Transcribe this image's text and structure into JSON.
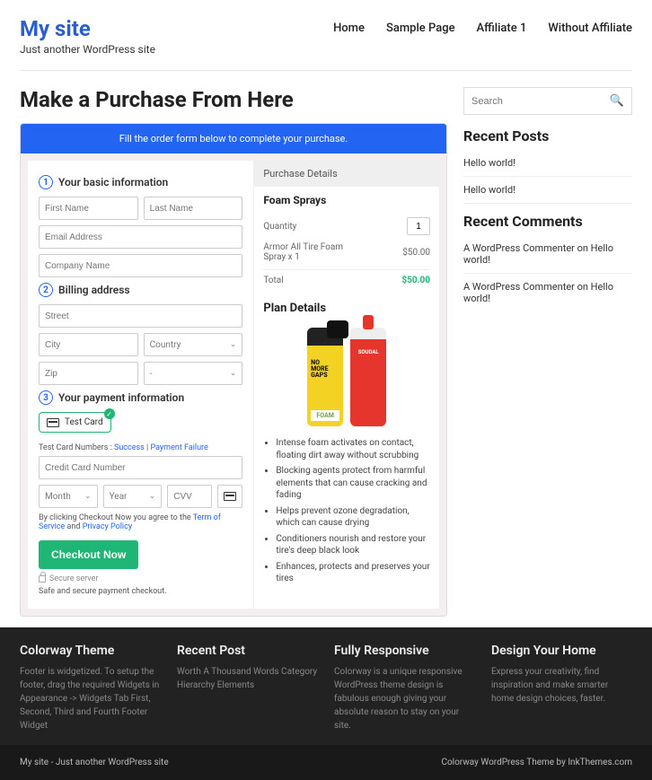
{
  "brand": {
    "title": "My site",
    "tagline": "Just another WordPress site"
  },
  "nav": {
    "home": "Home",
    "sample": "Sample Page",
    "affiliate": "Affiliate 1",
    "without": "Without Affiliate"
  },
  "page": {
    "title": "Make a Purchase From Here"
  },
  "checkout": {
    "banner": "Fill the order form below to complete your purchase.",
    "step1": {
      "num": "1",
      "title": "Your basic information",
      "first": "First Name",
      "last": "Last Name",
      "email": "Email Address",
      "company": "Company Name"
    },
    "step2": {
      "num": "2",
      "title": "Billing address",
      "street": "Street",
      "city": "City",
      "country": "Country",
      "zip": "Zip",
      "state": "-"
    },
    "step3": {
      "num": "3",
      "title": "Your payment information",
      "testcard": "Test Card",
      "note_pre": "Test Card Numbers : ",
      "note_success": "Success",
      "note_sep": " | ",
      "note_fail": "Payment Failure",
      "cc": "Credit Card Number",
      "month": "Month",
      "year": "Year",
      "cvv": "CVV",
      "terms_pre": "By clicking Checkout Now you agree to the ",
      "terms_tos": "Term of Service",
      "terms_and": " and ",
      "terms_pp": "Privacy Policy",
      "button": "Checkout Now",
      "secure": "Secure server",
      "safe": "Safe and secure payment checkout."
    }
  },
  "purchase": {
    "header": "Purchase Details",
    "product": "Foam Sprays",
    "qty_label": "Quantity",
    "qty_value": "1",
    "line_item": "Armor All Tire Foam Spray x 1",
    "line_price": "$50.00",
    "total_label": "Total",
    "total_value": "$50.00"
  },
  "plan": {
    "header": "Plan Details",
    "can1a": "NO",
    "can1b": "MORE",
    "can1c": "GAPS",
    "can1d": "FOAM",
    "can2": "SOUDAL",
    "bullets": [
      "Intense foam activates on contact, floating dirt away without scrubbing",
      "Blocking agents protect from harmful elements that can cause cracking and fading",
      "Helps prevent ozone degradation, which can cause drying",
      "Conditioners nourish and restore your tire's deep black look",
      "Enhances, protects and preserves your tires"
    ]
  },
  "sidebar": {
    "search": "Search",
    "recent_posts": {
      "title": "Recent Posts",
      "items": [
        "Hello world!",
        "Hello world!"
      ]
    },
    "recent_comments": {
      "title": "Recent Comments",
      "items": [
        "A WordPress Commenter on Hello world!",
        "A WordPress Commenter on Hello world!"
      ]
    }
  },
  "footer": {
    "cols": [
      {
        "title": "Colorway Theme",
        "body": "Footer is widgetized. To setup the footer, drag the required Widgets in Appearance -> Widgets Tab First, Second, Third and Fourth Footer Widget"
      },
      {
        "title": "Recent Post",
        "body": "Worth A Thousand Words Category Hierarchy Elements"
      },
      {
        "title": "Fully Responsive",
        "body": "Colorway is a unique responsive WordPress theme design is fabulous enough giving your absolute reason to stay on your site."
      },
      {
        "title": "Design Your Home",
        "body": "Express your creativity, find inspiration and make smarter home design choices, faster."
      }
    ],
    "bar_left": "My site - Just another WordPress site",
    "bar_right": "Colorway WordPress Theme by InkThemes.com"
  }
}
